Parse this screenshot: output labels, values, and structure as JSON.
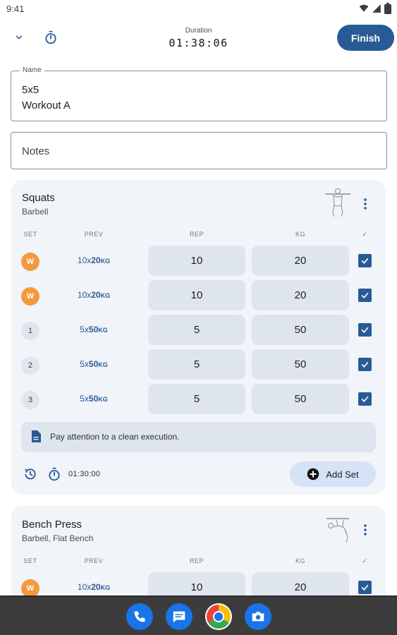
{
  "status_bar": {
    "time": "9:41"
  },
  "header": {
    "duration_label": "Duration",
    "duration_value": "01:38:06",
    "finish_label": "Finish"
  },
  "name_field": {
    "label": "Name",
    "line1": "5x5",
    "line2": "Workout A"
  },
  "notes_field": {
    "placeholder": "Notes"
  },
  "table_headers": {
    "set": "SET",
    "prev": "PREV",
    "rep": "REP",
    "kg": "KG",
    "done": "✓"
  },
  "exercises": [
    {
      "title": "Squats",
      "subtitle": "Barbell",
      "sets": [
        {
          "badge": "W",
          "type": "warmup",
          "prev_reps": "10",
          "prev_x": "x",
          "prev_weight": "20",
          "prev_unit": "KG",
          "rep": "10",
          "kg": "20",
          "done": true
        },
        {
          "badge": "W",
          "type": "warmup",
          "prev_reps": "10",
          "prev_x": "x",
          "prev_weight": "20",
          "prev_unit": "KG",
          "rep": "10",
          "kg": "20",
          "done": true
        },
        {
          "badge": "1",
          "type": "working",
          "prev_reps": "5",
          "prev_x": "x",
          "prev_weight": "50",
          "prev_unit": "KG",
          "rep": "5",
          "kg": "50",
          "done": true
        },
        {
          "badge": "2",
          "type": "working",
          "prev_reps": "5",
          "prev_x": "x",
          "prev_weight": "50",
          "prev_unit": "KG",
          "rep": "5",
          "kg": "50",
          "done": true
        },
        {
          "badge": "3",
          "type": "working",
          "prev_reps": "5",
          "prev_x": "x",
          "prev_weight": "50",
          "prev_unit": "KG",
          "rep": "5",
          "kg": "50",
          "done": true
        }
      ],
      "note": "Pay attention to a clean execution.",
      "rest_time": "01:30:00",
      "add_set_label": "Add Set"
    },
    {
      "title": "Bench Press",
      "subtitle": "Barbell, Flat Bench",
      "sets": [
        {
          "badge": "W",
          "type": "warmup",
          "prev_reps": "10",
          "prev_x": "x",
          "prev_weight": "20",
          "prev_unit": "KG",
          "rep": "10",
          "kg": "20",
          "done": true
        }
      ]
    }
  ],
  "colors": {
    "primary": "#285b96",
    "warmup": "#f49a3e",
    "card": "#f1f4f9",
    "input": "#dfe5ee",
    "add_set": "#d4e3f5"
  },
  "dock": [
    "phone-icon",
    "messages-icon",
    "chrome-icon",
    "camera-icon"
  ]
}
